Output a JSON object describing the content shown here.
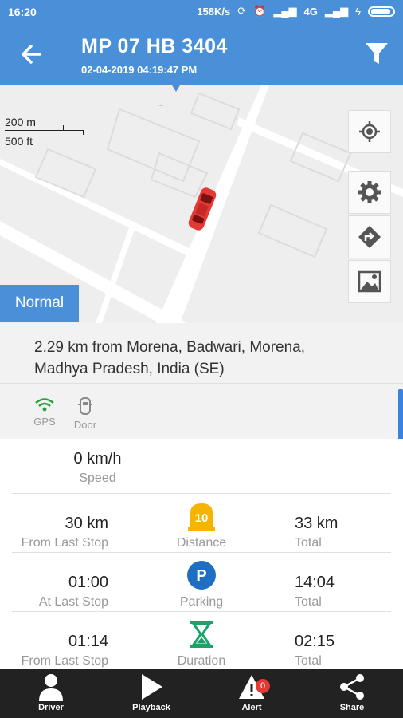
{
  "status_bar": {
    "time": "16:20",
    "speed": "158K/s",
    "network": "4G"
  },
  "header": {
    "title": "MP 07 HB 3404",
    "subtitle": "02-04-2019 04:19:47 PM"
  },
  "map": {
    "scale_metric": "200 m",
    "scale_imperial": "500 ft",
    "map_type_label": "Normal",
    "vehicle_color": "#e53935"
  },
  "address": {
    "line1": "2.29 km from Morena, Badwari, Morena,",
    "line2": "Madhya Pradesh, India (SE)"
  },
  "sensors": [
    {
      "label": "GPS",
      "icon": "wifi-icon",
      "color": "#2e9e3e"
    },
    {
      "label": "Door",
      "icon": "door-icon",
      "color": "#999999"
    }
  ],
  "stats": {
    "speed": {
      "value": "0 km/h",
      "label": "Speed"
    },
    "rows": [
      {
        "left_value": "30 km",
        "left_label": "From Last Stop",
        "mid_label": "Distance",
        "icon": "milestone-icon",
        "icon_text": "10",
        "right_value": "33 km",
        "right_label": "Total"
      },
      {
        "left_value": "01:00",
        "left_label": "At Last Stop",
        "mid_label": "Parking",
        "icon": "parking-icon",
        "icon_text": "P",
        "right_value": "14:04",
        "right_label": "Total"
      },
      {
        "left_value": "01:14",
        "left_label": "From Last Stop",
        "mid_label": "Duration",
        "icon": "hourglass-icon",
        "icon_text": "",
        "right_value": "02:15",
        "right_label": "Total"
      }
    ]
  },
  "nav": {
    "driver": "Driver",
    "playback": "Playback",
    "alert": "Alert",
    "alert_count": "0",
    "share": "Share"
  },
  "colors": {
    "primary": "#4a90d9",
    "nav_bg": "#222222",
    "badge": "#e53935"
  }
}
